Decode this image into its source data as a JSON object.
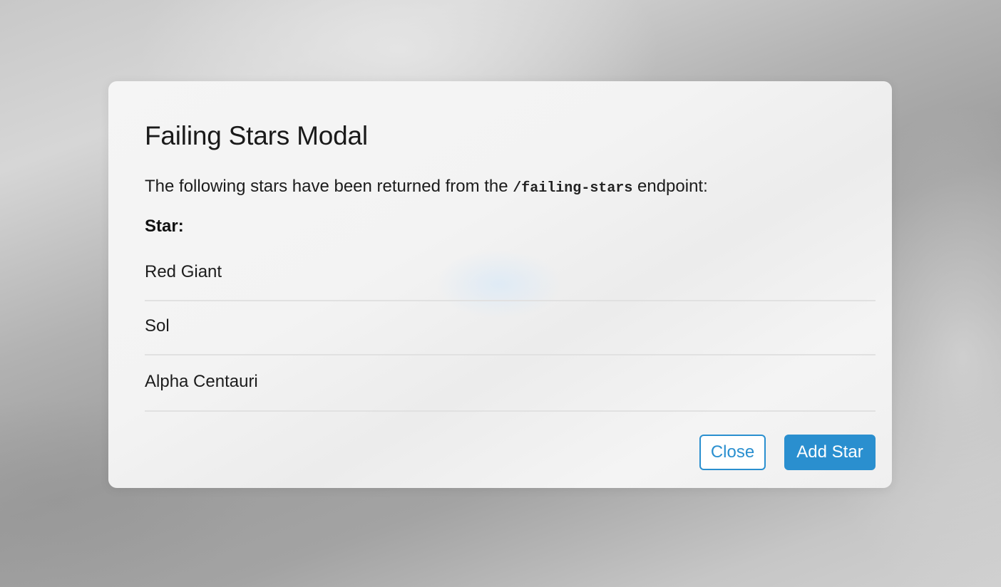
{
  "modal": {
    "title": "Failing Stars Modal",
    "description_prefix": "The following stars have been returned from the",
    "endpoint": "/failing-stars",
    "description_suffix": "endpoint:",
    "list_header": "Star:",
    "stars": [
      "Red Giant",
      "Sol",
      "Alpha Centauri"
    ],
    "close_label": "Close",
    "add_label": "Add Star"
  },
  "colors": {
    "accent": "#2a8fcf",
    "modal_background": "#f3f3f3",
    "divider": "#e1e1e1"
  }
}
